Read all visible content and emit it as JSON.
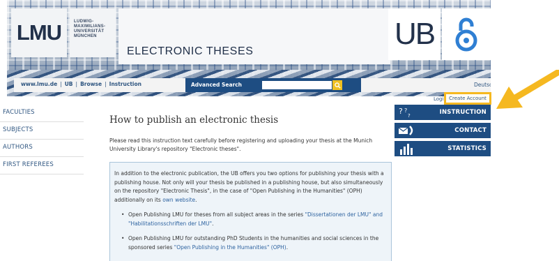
{
  "header": {
    "lmu_logo": "LMU",
    "lmu_name_lines": [
      "LUDWIG-",
      "MAXIMILIANS-",
      "UNIVERSITÄT",
      "MÜNCHEN"
    ],
    "site_title": "ELECTRONIC THESES",
    "ub_logo": "UB"
  },
  "nav": {
    "links": [
      "www.lmu.de",
      "UB",
      "Browse",
      "Instruction"
    ],
    "separator": "|",
    "advanced_search_label": "Advanced Search",
    "search_value": "",
    "language_link": "Deutsch"
  },
  "account": {
    "login_label": "Logi",
    "create_account_label": "Create Account"
  },
  "left_nav": {
    "items": [
      "FACULTIES",
      "SUBJECTS",
      "AUTHORS",
      "FIRST REFEREES"
    ]
  },
  "main": {
    "heading": "How to publish an electronic thesis",
    "intro": "Please read this instruction text carefully before registering and uploading your thesis at the Munich University Library's repository \"Electronic theses\".",
    "box_para_before_link": "In addition to the electronic publication, the UB offers you two options for publishing your thesis with a publishing house. Not only will your thesis be published in a publishing house, but also simultaneously on the repository \"Electronic Thesis\", in the case of \"Open Publishing in the Humanities\" (OPH) additionally on its ",
    "box_para_link": "own website",
    "box_para_after_link": ".",
    "bullets": [
      {
        "before": "Open Publishing LMU for theses from all subject areas in the series ",
        "link": "\"Dissertationen der LMU\" and \"Habilitationsschriften der LMU\"",
        "after": "."
      },
      {
        "before": "Open Publishing LMU for outstanding PhD Students in the humanities and social sciences in the sponsored series ",
        "link": "\"Open Publishing in the Humanities\" (OPH)",
        "after": "."
      }
    ]
  },
  "right_nav": {
    "items": [
      {
        "label": "INSTRUCTION",
        "icon": "question-icon"
      },
      {
        "label": "CONTACT",
        "icon": "envelope-phone-icon"
      },
      {
        "label": "STATISTICS",
        "icon": "bar-chart-icon"
      }
    ]
  },
  "colors": {
    "primary_blue": "#1e4d82",
    "link_blue": "#2e5580",
    "highlight_orange": "#f5b820",
    "info_box_bg": "#eef4f9"
  }
}
